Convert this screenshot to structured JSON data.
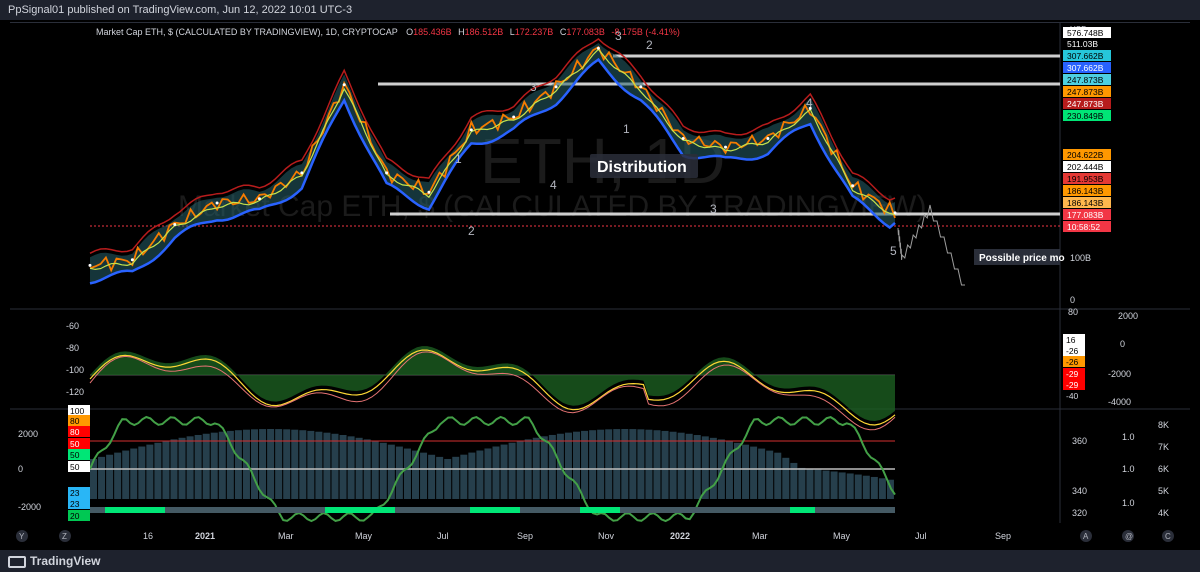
{
  "header": {
    "published": "PpSignal01 published on TradingView.com, Jun 12, 2022 10:01 UTC-3"
  },
  "legend": {
    "symbol": "Market Cap ETH, $ (CALCULATED BY TRADINGVIEW), 1D, CRYPTOCAP",
    "o_label": "O",
    "o": "185.436B",
    "h_label": "H",
    "h": "186.512B",
    "l_label": "L",
    "l": "172.237B",
    "c_label": "C",
    "c": "177.083B",
    "change": "-8.175B (-4.41%)"
  },
  "watermark": {
    "big": "ETH, 1D",
    "sub": "Market Cap ETH, $ (CALCULATED BY TRADINGVIEW)"
  },
  "annotations": {
    "distribution": "Distribution",
    "possible_move": "Possible price mo",
    "waves": [
      {
        "label": "3",
        "color": "#b2b5be"
      },
      {
        "label": "2",
        "color": "#b2b5be"
      },
      {
        "label": "3",
        "color": "#b2b5be"
      },
      {
        "label": "1",
        "color": "#b2b5be"
      },
      {
        "label": "1",
        "color": "#b2b5be"
      },
      {
        "label": "4",
        "color": "#b2b5be"
      },
      {
        "label": "2",
        "color": "#b2b5be"
      },
      {
        "label": "3",
        "color": "#b2b5be"
      },
      {
        "label": "4",
        "color": "#b2b5be"
      },
      {
        "label": "5",
        "color": "#b2b5be"
      }
    ]
  },
  "price_axis": {
    "currency": "USD",
    "labels": [
      {
        "text": "576.748B",
        "bg": "#ffffff",
        "fg": "#000000"
      },
      {
        "text": "511.03B",
        "bg": "#000000",
        "fg": "#ffffff"
      },
      {
        "text": "307.662B",
        "bg": "#26c6da",
        "fg": "#000000"
      },
      {
        "text": "307.662B",
        "bg": "#2962ff",
        "fg": "#ffffff"
      },
      {
        "text": "247.873B",
        "bg": "#4dd0e1",
        "fg": "#000000"
      },
      {
        "text": "247.873B",
        "bg": "#ff9800",
        "fg": "#000000"
      },
      {
        "text": "247.873B",
        "bg": "#b71c1c",
        "fg": "#ffffff"
      },
      {
        "text": "230.849B",
        "bg": "#00e676",
        "fg": "#000000"
      },
      {
        "text": "204.622B",
        "bg": "#ff9800",
        "fg": "#000000"
      },
      {
        "text": "202.444B",
        "bg": "#ffffff",
        "fg": "#000000"
      },
      {
        "text": "191.953B",
        "bg": "#e53935",
        "fg": "#000000"
      },
      {
        "text": "186.143B",
        "bg": "#ff9800",
        "fg": "#000000"
      },
      {
        "text": "186.143B",
        "bg": "#ffb74d",
        "fg": "#000000"
      },
      {
        "text": "177.083B",
        "bg": "#f23645",
        "fg": "#ffffff"
      },
      {
        "text": "10:58:52",
        "bg": "#f23645",
        "fg": "#ffffff"
      }
    ],
    "ticks": [
      "100B",
      "0"
    ]
  },
  "osc1": {
    "left_ticks": [
      "-60",
      "-80",
      "-100",
      "-120"
    ],
    "right_ticks": [
      "80",
      "2000",
      "0",
      "-2000",
      "-4000"
    ],
    "badges": [
      {
        "text": "16",
        "bg": "#ffffff",
        "fg": "#000000"
      },
      {
        "text": "-26",
        "bg": "#ffffff",
        "fg": "#000000"
      },
      {
        "text": "-26",
        "bg": "#ff9800",
        "fg": "#000000"
      },
      {
        "text": "-29",
        "bg": "#ff0000",
        "fg": "#ffffff"
      },
      {
        "text": "-29",
        "bg": "#ff0000",
        "fg": "#ffffff"
      },
      {
        "text": "-40",
        "bg": "#000000",
        "fg": "#d1d4dc"
      }
    ]
  },
  "osc2": {
    "left_ticks": [
      "2000",
      "0",
      "-2000"
    ],
    "badges": [
      {
        "text": "100",
        "bg": "#ffffff",
        "fg": "#000000"
      },
      {
        "text": "80",
        "bg": "#ff9800",
        "fg": "#000000"
      },
      {
        "text": "80",
        "bg": "#ff0000",
        "fg": "#ffffff"
      },
      {
        "text": "50",
        "bg": "#ff0000",
        "fg": "#ffffff"
      },
      {
        "text": "50",
        "bg": "#00e676",
        "fg": "#000000"
      },
      {
        "text": "50",
        "bg": "#ffffff",
        "fg": "#000000"
      },
      {
        "text": "23",
        "bg": "#29b6f6",
        "fg": "#000000"
      },
      {
        "text": "23",
        "bg": "#29b6f6",
        "fg": "#000000"
      },
      {
        "text": "20",
        "bg": "#00c853",
        "fg": "#000000"
      }
    ],
    "mid_ticks": [
      "360",
      "340",
      "320"
    ],
    "ratio_ticks": [
      "1.0",
      "1.0",
      "1.0"
    ],
    "k_ticks": [
      "8K",
      "7K",
      "6K",
      "5K",
      "4K"
    ]
  },
  "time_axis": [
    "16",
    "2021",
    "Mar",
    "May",
    "Jul",
    "Sep",
    "Nov",
    "2022",
    "Mar",
    "May",
    "Jul",
    "Sep"
  ],
  "footer": {
    "brand": "TradingView",
    "left_buttons": [
      "Y",
      "Z"
    ],
    "right_buttons": [
      "A",
      "@",
      "C"
    ]
  },
  "chart_data": {
    "type": "line",
    "title": "Market Cap ETH, $ (CALCULATED BY TRADINGVIEW), 1D, CRYPTOCAP",
    "x": [
      "2020-11",
      "2020-12",
      "2021-01",
      "2021-02",
      "2021-03",
      "2021-04",
      "2021-05",
      "2021-06",
      "2021-07",
      "2021-08",
      "2021-09",
      "2021-10",
      "2021-11",
      "2021-12",
      "2022-01",
      "2022-02",
      "2022-03",
      "2022-04",
      "2022-05",
      "2022-06"
    ],
    "series": [
      {
        "values": [
          55,
          68,
          150,
          200,
          210,
          270,
          475,
          270,
          225,
          370,
          400,
          470,
          560,
          470,
          350,
          330,
          350,
          420,
          240,
          177
        ]
      }
    ],
    "ylabel": "USD",
    "ylim": [
      0,
      600
    ],
    "grid": false
  }
}
